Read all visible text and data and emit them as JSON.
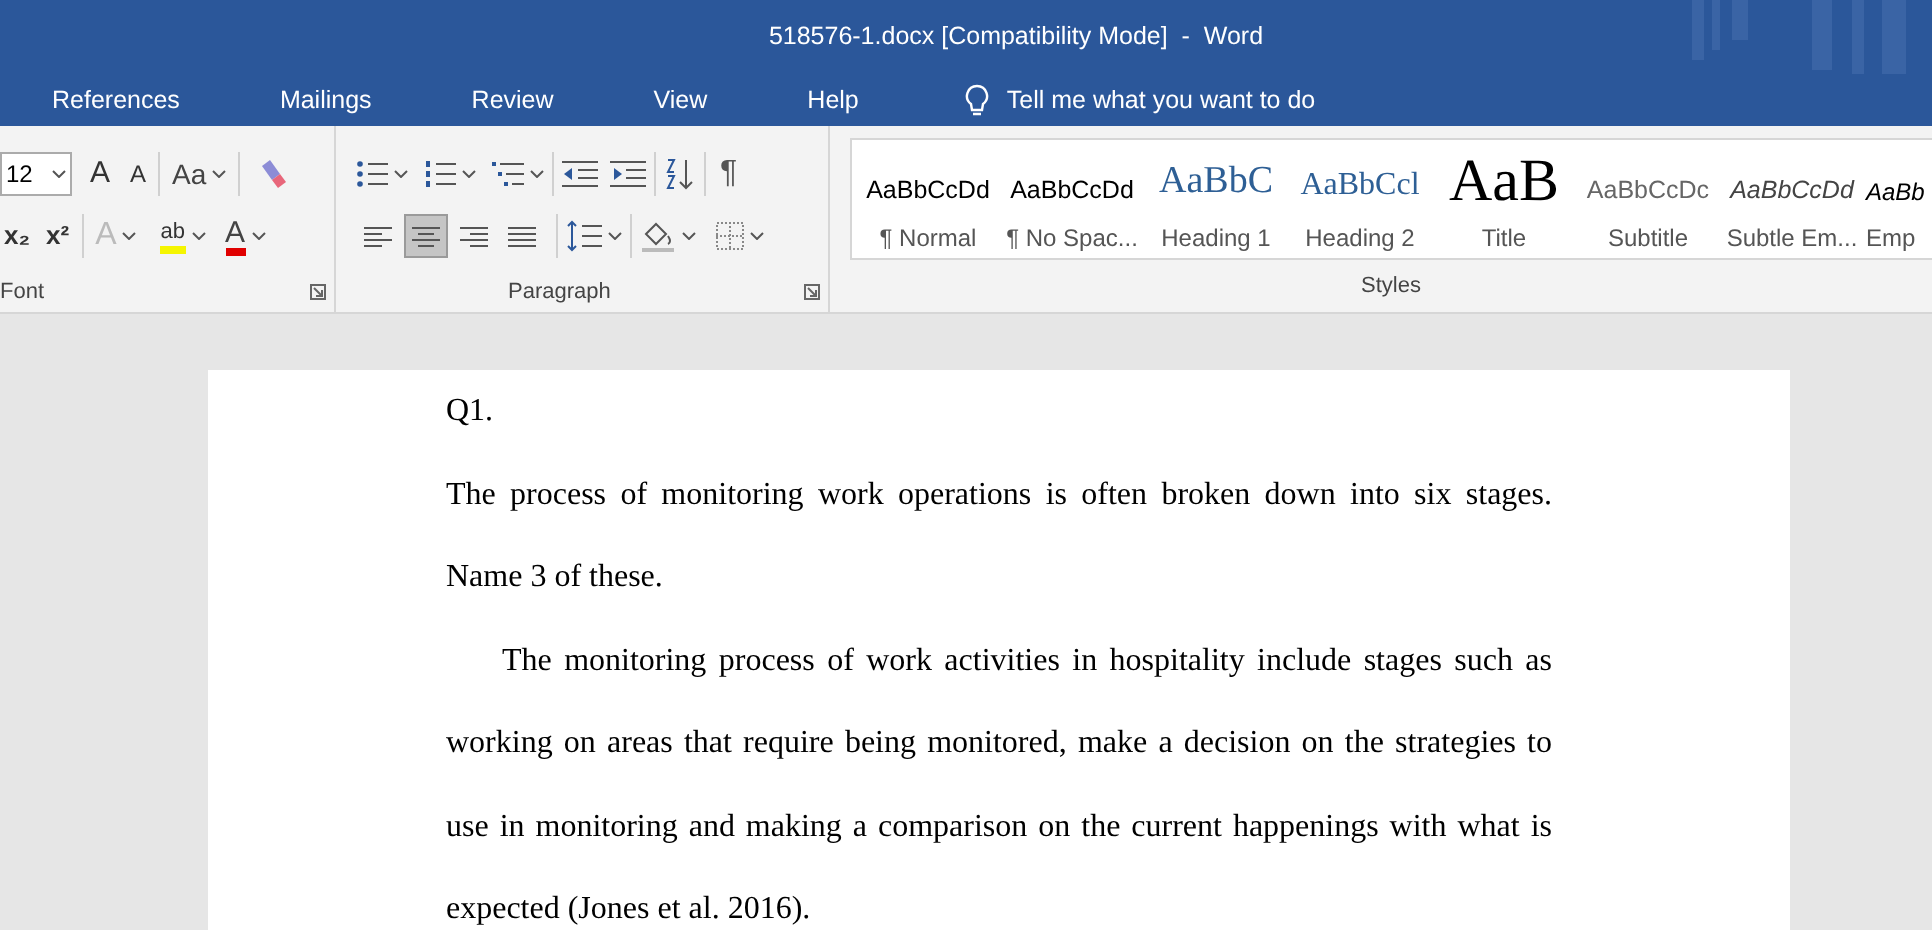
{
  "window": {
    "title": "518576-1.docx [Compatibility Mode]  -  Word"
  },
  "tabs": [
    {
      "label": "References",
      "selected": false
    },
    {
      "label": "Mailings",
      "selected": false
    },
    {
      "label": "Review",
      "selected": false
    },
    {
      "label": "View",
      "selected": false
    },
    {
      "label": "Help",
      "selected": false
    }
  ],
  "tell_me": {
    "placeholder": "Tell me what you want to do"
  },
  "font_group": {
    "label": "Font",
    "size": "12",
    "grow": "A",
    "shrink": "A",
    "change_case": "Aa",
    "subscript": "x₂",
    "superscript": "x²",
    "text_effects": "A",
    "highlight": "ab",
    "font_color": "A"
  },
  "paragraph_group": {
    "label": "Paragraph",
    "show_marks": "¶",
    "alignments": [
      {
        "kind": "left",
        "selected": false
      },
      {
        "kind": "center",
        "selected": true
      },
      {
        "kind": "right",
        "selected": false
      },
      {
        "kind": "justify",
        "selected": false
      }
    ]
  },
  "styles_group": {
    "label": "Styles",
    "styles": [
      {
        "kind": "normal",
        "preview": "AaBbCcDd",
        "label": "¶ Normal"
      },
      {
        "kind": "normal",
        "preview": "AaBbCcDd",
        "label": "¶ No Spac..."
      },
      {
        "kind": "heading1",
        "preview": "AaBbC",
        "label": "Heading 1"
      },
      {
        "kind": "heading2",
        "preview": "AaBbCcl",
        "label": "Heading 2"
      },
      {
        "kind": "title",
        "preview": "AaB",
        "label": "Title"
      },
      {
        "kind": "subtitle",
        "preview": "AaBbCcDc",
        "label": "Subtitle"
      },
      {
        "kind": "emphasis",
        "preview": "AaBbCcDd",
        "label": "Subtle Em..."
      },
      {
        "kind": "emphasis_strong",
        "preview": "AaBb",
        "label": "Emp"
      }
    ]
  },
  "document": {
    "paragraphs": [
      {
        "kind": "plain",
        "text": "Q1."
      },
      {
        "kind": "plain",
        "text": "The process of monitoring work operations is often broken down into six stages. Name 3 of these."
      },
      {
        "kind": "indented",
        "text": "The monitoring process of work activities in hospitality include stages such as working on areas that require being monitored, make a decision on the strategies to use in monitoring and making a comparison on the current happenings with what is expected (Jones et al. 2016)."
      }
    ]
  }
}
